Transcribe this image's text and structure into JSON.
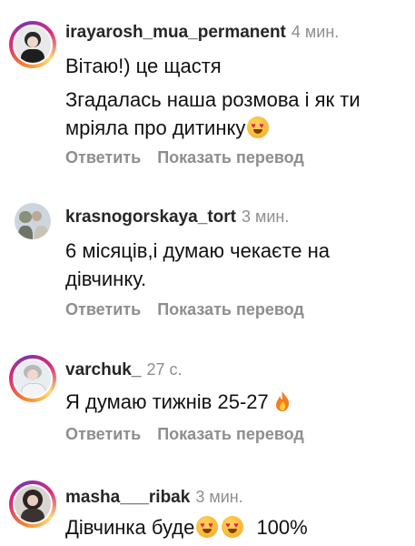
{
  "comments": [
    {
      "username": "irayarosh_mua_permanent",
      "time": "4 мин.",
      "text_lines": [
        "Вітаю!) це щастя",
        "Згадалась наша розмова і як ти",
        "мріяла про дитинку"
      ],
      "reply": "Ответить",
      "translate": "Показать перевод"
    },
    {
      "username": "krasnogorskaya_tort",
      "time": "3 мин.",
      "text_lines": [
        "6 місяців,і думаю чекаєте на",
        "дівчинку."
      ],
      "reply": "Ответить",
      "translate": "Показать перевод"
    },
    {
      "username": "varchuk_",
      "time": "27 с.",
      "text_lines": [
        "Я думаю тижнів 25-27"
      ],
      "reply": "Ответить",
      "translate": "Показать перевод"
    },
    {
      "username": "masha___ribak",
      "time": "3 мин.",
      "text_lines": [
        "Дівчинка буде",
        "100%"
      ]
    }
  ],
  "colors": {
    "meta_gray": "#8e8e8e",
    "story_ring": "#dd2a7b"
  },
  "icons": {
    "emoji": "heart-eyes-emoji",
    "fire": "fire-emoji"
  }
}
